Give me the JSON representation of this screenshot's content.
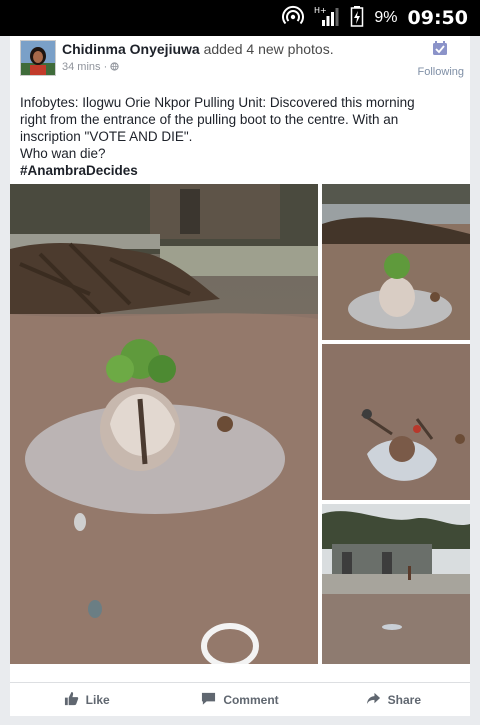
{
  "status_bar": {
    "battery_level": "9%",
    "time": "09:50",
    "icons": [
      "hotspot-icon",
      "signal-icon",
      "battery-icon"
    ]
  },
  "post": {
    "author": "Chidinma Onyejiuwa",
    "action": "added 4 new photos.",
    "time_ago": "34 mins",
    "audience_icon": "globe-icon",
    "follow_label": "Following",
    "text_lines": [
      "Infobytes: Ilogwu Orie Nkpor Pulling Unit: Discovered this morning",
      "right from the entrance of the pulling boot to the centre. With an",
      "inscription \"VOTE AND DIE\".",
      "Who wan die?"
    ],
    "hashtag": "#AnambraDecides"
  },
  "actions": {
    "like": "Like",
    "comment": "Comment",
    "share": "Share"
  },
  "colors": {
    "status_bar_bg": "#000000",
    "page_bg": "#e9ebee",
    "card_bg": "#ffffff",
    "action_text": "#606770",
    "follow_text": "#7f8fa6"
  }
}
